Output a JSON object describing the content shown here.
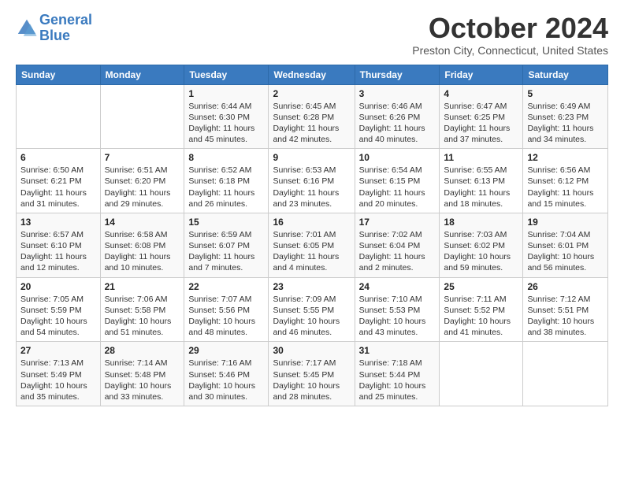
{
  "logo": {
    "line1": "General",
    "line2": "Blue"
  },
  "title": "October 2024",
  "location": "Preston City, Connecticut, United States",
  "days_of_week": [
    "Sunday",
    "Monday",
    "Tuesday",
    "Wednesday",
    "Thursday",
    "Friday",
    "Saturday"
  ],
  "weeks": [
    [
      {
        "day": "",
        "info": ""
      },
      {
        "day": "",
        "info": ""
      },
      {
        "day": "1",
        "sunrise": "6:44 AM",
        "sunset": "6:30 PM",
        "daylight": "11 hours and 45 minutes."
      },
      {
        "day": "2",
        "sunrise": "6:45 AM",
        "sunset": "6:28 PM",
        "daylight": "11 hours and 42 minutes."
      },
      {
        "day": "3",
        "sunrise": "6:46 AM",
        "sunset": "6:26 PM",
        "daylight": "11 hours and 40 minutes."
      },
      {
        "day": "4",
        "sunrise": "6:47 AM",
        "sunset": "6:25 PM",
        "daylight": "11 hours and 37 minutes."
      },
      {
        "day": "5",
        "sunrise": "6:49 AM",
        "sunset": "6:23 PM",
        "daylight": "11 hours and 34 minutes."
      }
    ],
    [
      {
        "day": "6",
        "sunrise": "6:50 AM",
        "sunset": "6:21 PM",
        "daylight": "11 hours and 31 minutes."
      },
      {
        "day": "7",
        "sunrise": "6:51 AM",
        "sunset": "6:20 PM",
        "daylight": "11 hours and 29 minutes."
      },
      {
        "day": "8",
        "sunrise": "6:52 AM",
        "sunset": "6:18 PM",
        "daylight": "11 hours and 26 minutes."
      },
      {
        "day": "9",
        "sunrise": "6:53 AM",
        "sunset": "6:16 PM",
        "daylight": "11 hours and 23 minutes."
      },
      {
        "day": "10",
        "sunrise": "6:54 AM",
        "sunset": "6:15 PM",
        "daylight": "11 hours and 20 minutes."
      },
      {
        "day": "11",
        "sunrise": "6:55 AM",
        "sunset": "6:13 PM",
        "daylight": "11 hours and 18 minutes."
      },
      {
        "day": "12",
        "sunrise": "6:56 AM",
        "sunset": "6:12 PM",
        "daylight": "11 hours and 15 minutes."
      }
    ],
    [
      {
        "day": "13",
        "sunrise": "6:57 AM",
        "sunset": "6:10 PM",
        "daylight": "11 hours and 12 minutes."
      },
      {
        "day": "14",
        "sunrise": "6:58 AM",
        "sunset": "6:08 PM",
        "daylight": "11 hours and 10 minutes."
      },
      {
        "day": "15",
        "sunrise": "6:59 AM",
        "sunset": "6:07 PM",
        "daylight": "11 hours and 7 minutes."
      },
      {
        "day": "16",
        "sunrise": "7:01 AM",
        "sunset": "6:05 PM",
        "daylight": "11 hours and 4 minutes."
      },
      {
        "day": "17",
        "sunrise": "7:02 AM",
        "sunset": "6:04 PM",
        "daylight": "11 hours and 2 minutes."
      },
      {
        "day": "18",
        "sunrise": "7:03 AM",
        "sunset": "6:02 PM",
        "daylight": "10 hours and 59 minutes."
      },
      {
        "day": "19",
        "sunrise": "7:04 AM",
        "sunset": "6:01 PM",
        "daylight": "10 hours and 56 minutes."
      }
    ],
    [
      {
        "day": "20",
        "sunrise": "7:05 AM",
        "sunset": "5:59 PM",
        "daylight": "10 hours and 54 minutes."
      },
      {
        "day": "21",
        "sunrise": "7:06 AM",
        "sunset": "5:58 PM",
        "daylight": "10 hours and 51 minutes."
      },
      {
        "day": "22",
        "sunrise": "7:07 AM",
        "sunset": "5:56 PM",
        "daylight": "10 hours and 48 minutes."
      },
      {
        "day": "23",
        "sunrise": "7:09 AM",
        "sunset": "5:55 PM",
        "daylight": "10 hours and 46 minutes."
      },
      {
        "day": "24",
        "sunrise": "7:10 AM",
        "sunset": "5:53 PM",
        "daylight": "10 hours and 43 minutes."
      },
      {
        "day": "25",
        "sunrise": "7:11 AM",
        "sunset": "5:52 PM",
        "daylight": "10 hours and 41 minutes."
      },
      {
        "day": "26",
        "sunrise": "7:12 AM",
        "sunset": "5:51 PM",
        "daylight": "10 hours and 38 minutes."
      }
    ],
    [
      {
        "day": "27",
        "sunrise": "7:13 AM",
        "sunset": "5:49 PM",
        "daylight": "10 hours and 35 minutes."
      },
      {
        "day": "28",
        "sunrise": "7:14 AM",
        "sunset": "5:48 PM",
        "daylight": "10 hours and 33 minutes."
      },
      {
        "day": "29",
        "sunrise": "7:16 AM",
        "sunset": "5:46 PM",
        "daylight": "10 hours and 30 minutes."
      },
      {
        "day": "30",
        "sunrise": "7:17 AM",
        "sunset": "5:45 PM",
        "daylight": "10 hours and 28 minutes."
      },
      {
        "day": "31",
        "sunrise": "7:18 AM",
        "sunset": "5:44 PM",
        "daylight": "10 hours and 25 minutes."
      },
      {
        "day": "",
        "info": ""
      },
      {
        "day": "",
        "info": ""
      }
    ]
  ],
  "labels": {
    "sunrise": "Sunrise:",
    "sunset": "Sunset:",
    "daylight": "Daylight:"
  }
}
